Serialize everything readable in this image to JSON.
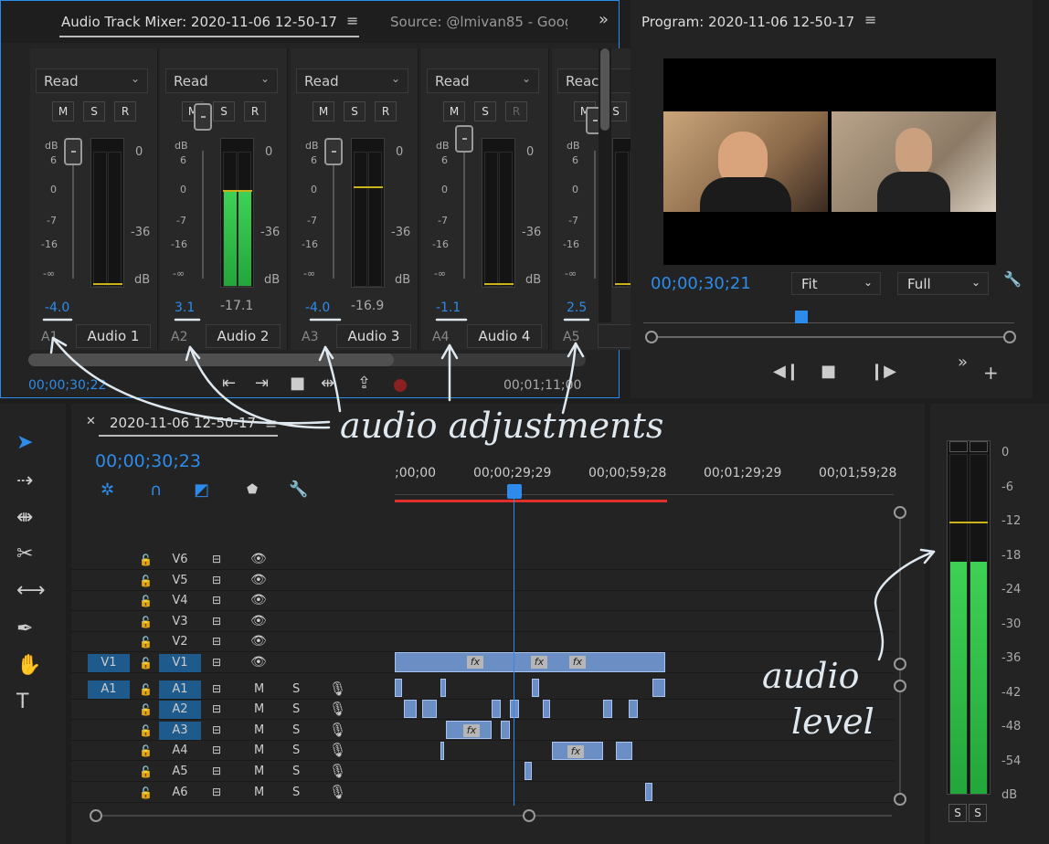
{
  "mixer": {
    "tab_title": "Audio Track Mixer: 2020-11-06 12-50-17",
    "source_tab": "Source: @lmivan85 - Goog",
    "overflow_icon": "double-chevron-right",
    "channels": [
      {
        "mode": "Read",
        "volume": "-4.0",
        "pan": "",
        "track": "A1",
        "name": "Audio 1"
      },
      {
        "mode": "Read",
        "volume": "3.1",
        "pan": "-17.1",
        "track": "A2",
        "name": "Audio 2"
      },
      {
        "mode": "Read",
        "volume": "-4.0",
        "pan": "-16.9",
        "track": "A3",
        "name": "Audio 3"
      },
      {
        "mode": "Read",
        "volume": "-1.1",
        "pan": "",
        "track": "A4",
        "name": "Audio 4"
      },
      {
        "mode": "Reac",
        "volume": "2.5",
        "pan": "",
        "track": "A5",
        "name": ""
      }
    ],
    "msr": [
      "M",
      "S",
      "R"
    ],
    "fader_scale": [
      "dB",
      "6",
      "0",
      "-7",
      "-16",
      "-∞"
    ],
    "meter_scale": [
      "0",
      "-36",
      "dB"
    ],
    "current_time": "00;00;30;22",
    "end_time": "00;01;11;00"
  },
  "program": {
    "title": "Program: 2020-11-06 12-50-17",
    "timecode": "00;00;30;21",
    "fit": "Fit",
    "quality": "Full"
  },
  "timeline": {
    "tab_title": "2020-11-06 12-50-17",
    "timecode": "00;00;30;23",
    "ruler": [
      ";00;00",
      "00;00;29;29",
      "00;00;59;28",
      "00;01;29;29",
      "00;01;59;28"
    ],
    "video_tracks": [
      "V6",
      "V5",
      "V4",
      "V3",
      "V2",
      "V1"
    ],
    "audio_tracks": [
      "A1",
      "A2",
      "A3",
      "A4",
      "A5",
      "A6"
    ],
    "source_v": "V1",
    "source_a": "A1",
    "m_label": "M",
    "s_label": "S",
    "fx_label": "fx"
  },
  "levels": {
    "scale": [
      "0",
      "-6",
      "-12",
      "-18",
      "-24",
      "-30",
      "-36",
      "-42",
      "-48",
      "-54",
      "dB"
    ],
    "solo": [
      "S",
      "S"
    ]
  },
  "annotations": {
    "audio_adjustments": "audio adjustments",
    "audio_level_1": "audio",
    "audio_level_2": "level"
  },
  "colors": {
    "accent": "#2d8ceb",
    "meter_green": "#35c94a",
    "playhead": "#2d8ceb",
    "workarea": "#e0302b"
  }
}
